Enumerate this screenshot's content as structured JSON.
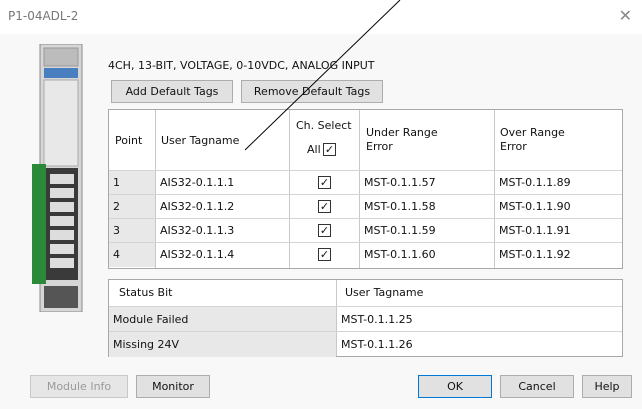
{
  "window": {
    "title": "P1-04ADL-2"
  },
  "description": "4CH, 13-BIT, VOLTAGE, 0-10VDC, ANALOG INPUT",
  "buttons": {
    "add_default_tags": "Add Default Tags",
    "remove_default_tags": "Remove Default Tags",
    "module_info": "Module Info",
    "monitor": "Monitor",
    "ok": "OK",
    "cancel": "Cancel",
    "help": "Help"
  },
  "point_table": {
    "headers": {
      "point": "Point",
      "user_tagname": "User Tagname",
      "ch_select": "Ch. Select",
      "all": "All",
      "under_range_line1": "Under Range",
      "under_range_line2": "Error",
      "over_range_line1": "Over Range",
      "over_range_line2": "Error"
    },
    "all_checked": true,
    "rows": [
      {
        "point": "1",
        "tagname": "AIS32-0.1.1.1",
        "checked": true,
        "under": "MST-0.1.1.57",
        "over": "MST-0.1.1.89"
      },
      {
        "point": "2",
        "tagname": "AIS32-0.1.1.2",
        "checked": true,
        "under": "MST-0.1.1.58",
        "over": "MST-0.1.1.90"
      },
      {
        "point": "3",
        "tagname": "AIS32-0.1.1.3",
        "checked": true,
        "under": "MST-0.1.1.59",
        "over": "MST-0.1.1.91"
      },
      {
        "point": "4",
        "tagname": "AIS32-0.1.1.4",
        "checked": true,
        "under": "MST-0.1.1.60",
        "over": "MST-0.1.1.92"
      }
    ]
  },
  "status_table": {
    "headers": {
      "status_bit": "Status Bit",
      "user_tagname": "User Tagname"
    },
    "rows": [
      {
        "status": "Module Failed",
        "tagname": "MST-0.1.1.25"
      },
      {
        "status": "Missing 24V",
        "tagname": "MST-0.1.1.26"
      }
    ]
  },
  "icons": {
    "close": "close-icon",
    "module": "module-image",
    "checkmark": "checkmark-icon"
  },
  "colors": {
    "focus_border": "#0078d7",
    "disabled_text": "#9a9a9a",
    "module_green": "#2a8a3a"
  }
}
